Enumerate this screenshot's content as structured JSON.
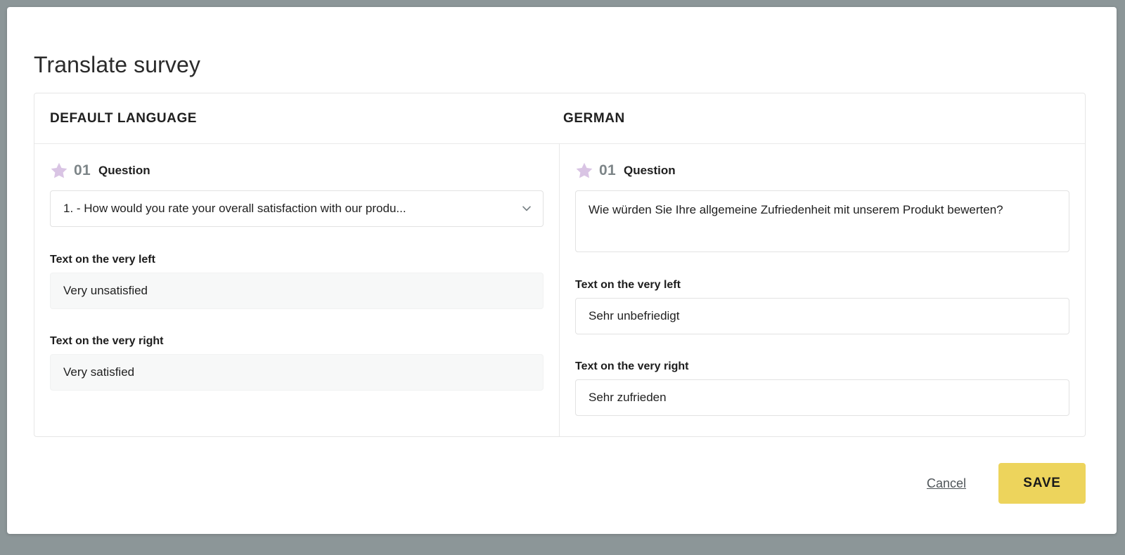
{
  "modal": {
    "title": "Translate survey"
  },
  "card": {
    "columns": [
      {
        "id": "default",
        "heading": "DEFAULT LANGUAGE"
      },
      {
        "id": "german",
        "heading": "GERMAN"
      }
    ]
  },
  "question": {
    "number": "01",
    "label": "Question",
    "star_icon": "star-icon",
    "chevron_icon": "chevron-down-icon",
    "default": {
      "select_value": "1. - How would you rate your overall satisfaction with our produ...",
      "left_label": "Text on the very left",
      "left_value": "Very unsatisfied",
      "right_label": "Text on the very right",
      "right_value": "Very satisfied"
    },
    "german": {
      "translation_value": "Wie würden Sie Ihre allgemeine Zufriedenheit mit unserem Produkt bewerten?",
      "left_label": "Text on the very left",
      "left_value": "Sehr unbefriedigt",
      "left_placeholder": "Text on the very left",
      "right_label": "Text on the very right",
      "right_value": "Sehr zufrieden",
      "right_placeholder": "Text on the very right"
    }
  },
  "footer": {
    "cancel_label": "Cancel",
    "save_label": "SAVE"
  },
  "colors": {
    "page_background": "#8c9698",
    "save_button": "#edd45c",
    "star": "#d9c4e4",
    "question_number": "#7d8588",
    "readonly_field": "#f7f8f8"
  }
}
